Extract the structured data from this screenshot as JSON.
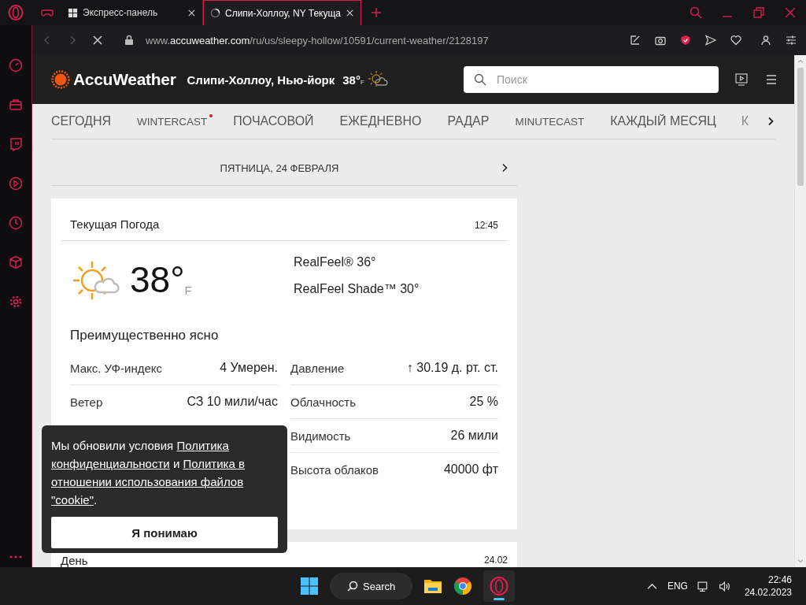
{
  "browser": {
    "tabs": [
      {
        "title": "Экспресс-панель",
        "selected": false,
        "kind": "speed-dial"
      },
      {
        "title": "Слипи-Холлоу, NY Текуща",
        "selected": true,
        "kind": "loading"
      }
    ],
    "url_parts": [
      "www.",
      "accuweather.com",
      "/ru/us/sleepy-hollow/10591/current-weather/2128197"
    ]
  },
  "header": {
    "brand": "AccuWeather",
    "location": "Слипи-Холлоу, Нью-йорк",
    "temp": "38°",
    "unit": "F",
    "search": {
      "placeholder": "Поиск"
    }
  },
  "nav": {
    "items": [
      {
        "label": "СЕГОДНЯ",
        "dot": false,
        "kind": "regular"
      },
      {
        "label": "WINTERCAST",
        "dot": true,
        "kind": "condensed"
      },
      {
        "label": "ПОЧАСОВОЙ",
        "dot": false,
        "kind": "regular"
      },
      {
        "label": "ЕЖЕДНЕВНО",
        "dot": false,
        "kind": "regular"
      },
      {
        "label": "РАДАР",
        "dot": false,
        "kind": "regular"
      },
      {
        "label": "MINUTECAST",
        "dot": false,
        "kind": "condensed"
      },
      {
        "label": "КАЖДЫЙ МЕСЯЦ",
        "dot": false,
        "kind": "regular"
      },
      {
        "label": "К",
        "dot": false,
        "kind": "faded"
      }
    ]
  },
  "date_bar": {
    "label": "ПЯТНИЦА, 24 ФЕВРАЛЯ"
  },
  "current": {
    "title": "Текущая Погода",
    "time": "12:45",
    "temp": "38°",
    "unit": "F",
    "realfeel": "RealFeel® 36°",
    "realfeel_shade": "RealFeel Shade™ 30°",
    "phrase": "Преимущественно ясно",
    "details_left": [
      {
        "label": "Макс. УФ-индекс",
        "value": "4 Умерен."
      },
      {
        "label": "Ветер",
        "value": "СЗ 10 мили/час"
      }
    ],
    "details_right": [
      {
        "label": "Давление",
        "value": "↑ 30.19 д. рт. ст."
      },
      {
        "label": "Облачность",
        "value": "25 %"
      },
      {
        "label": "Видимость",
        "value": "26 мили"
      },
      {
        "label": "Высота облаков",
        "value": "40000 фт"
      }
    ]
  },
  "day": {
    "title": "День",
    "date": "24.02"
  },
  "cookie": {
    "segments": [
      {
        "text": "Мы обновили условия ",
        "link": false
      },
      {
        "text": "Политика конфиденциальности",
        "link": true
      },
      {
        "text": " и ",
        "link": false
      },
      {
        "text": "Политика в отношении использования файлов \"cookie\"",
        "link": true
      },
      {
        "text": ".",
        "link": false
      }
    ],
    "button": "Я понимаю"
  },
  "taskbar": {
    "search": "Search",
    "language": "ENG",
    "time": "22:46",
    "date": "24.02.2023"
  }
}
